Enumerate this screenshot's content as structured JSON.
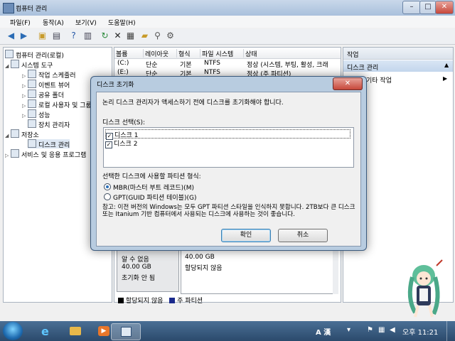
{
  "window": {
    "title": "컴퓨터 관리"
  },
  "menu": [
    "파일(F)",
    "동작(A)",
    "보기(V)",
    "도움말(H)"
  ],
  "tree": {
    "items": [
      {
        "label": "컴퓨터 관리(로컬)",
        "level": 0,
        "expander": ""
      },
      {
        "label": "시스템 도구",
        "level": 1,
        "expander": "◢"
      },
      {
        "label": "작업 스케줄러",
        "level": 2,
        "expander": "▷"
      },
      {
        "label": "이벤트 뷰어",
        "level": 2,
        "expander": "▷"
      },
      {
        "label": "공유 폴더",
        "level": 2,
        "expander": "▷"
      },
      {
        "label": "로컬 사용자 및 그룹",
        "level": 2,
        "expander": "▷"
      },
      {
        "label": "성능",
        "level": 2,
        "expander": "▷"
      },
      {
        "label": "장치 관리자",
        "level": 2,
        "expander": ""
      },
      {
        "label": "저장소",
        "level": 1,
        "expander": "◢"
      },
      {
        "label": "디스크 관리",
        "level": 2,
        "expander": ""
      },
      {
        "label": "서비스 및 응용 프로그램",
        "level": 1,
        "expander": "▷"
      }
    ]
  },
  "volumes": {
    "headers": [
      "볼륨",
      "레이아웃",
      "형식",
      "파일 시스템",
      "상태"
    ],
    "rows": [
      [
        "(C:)",
        "단순",
        "기본",
        "NTFS",
        "정상 (시스템, 부팅, 활성, 크래"
      ],
      [
        "(E:)",
        "단순",
        "기본",
        "NTFS",
        "정상 (주 파티션)"
      ]
    ]
  },
  "disk_map": {
    "left_lines": [
      "알 수 없음",
      "40.00 GB",
      "초기화 안 됨"
    ],
    "size": "40.00 GB",
    "state": "할당되지 않음"
  },
  "legend": [
    {
      "label": "할당되지 않음",
      "color": "#000000"
    },
    {
      "label": "주 파티션",
      "color": "#1a2a8c"
    }
  ],
  "actions": {
    "header": "작업",
    "selected": "디스크 관리",
    "more": "기타 작업"
  },
  "dialog": {
    "title": "디스크 초기화",
    "message": "논리 디스크 관리자가 액세스하기 전에 디스크를 초기화해야 합니다.",
    "select_label": "디스크 선택(S):",
    "disks": [
      {
        "label": "디스크 1",
        "checked": "✓"
      },
      {
        "label": "디스크 2",
        "checked": "✓"
      }
    ],
    "partition_label": "선택한 디스크에 사용할 파티션 형식:",
    "options": [
      "MBR(마스터 부트 레코드)(M)",
      "GPT(GUID 파티션 테이블)(G)"
    ],
    "note": "참고: 이전 버전의 Windows는 모두 GPT 파티션 스타일을 인식하지 못합니다. 2TB보다 큰 디스크 또는 Itanium 기반 컴퓨터에서 사용되는 디스크에 사용하는 것이 좋습니다.",
    "ok": "확인",
    "cancel": "취소"
  },
  "taskbar": {
    "ime": "A 漢",
    "time": "오후 11:21"
  },
  "colors": {
    "selection": "#dde7f3",
    "legend_primary": "#1a2a8c"
  },
  "icons": [
    "back-icon",
    "forward-icon",
    "folder-icon",
    "help-icon",
    "refresh-icon",
    "delete-icon",
    "properties-icon"
  ]
}
